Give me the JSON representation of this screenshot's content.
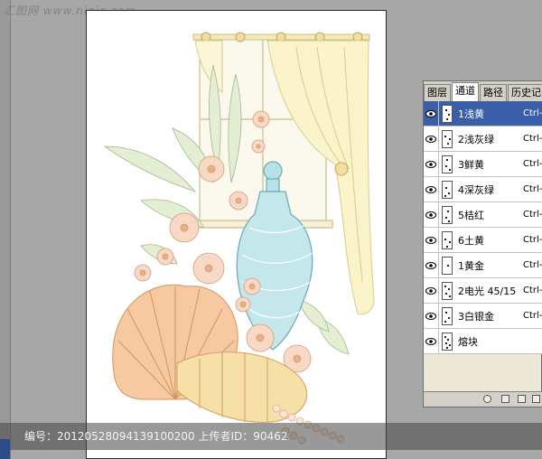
{
  "site_watermark": "汇图网 www.nipic.com",
  "panel": {
    "tabs": [
      "图层",
      "通道",
      "路径",
      "历史记录"
    ],
    "active_tab": 1,
    "channels": [
      {
        "name": "1浅黄",
        "shortcut": "Ctrl-",
        "selected": true
      },
      {
        "name": "2浅灰绿",
        "shortcut": "Ctrl-",
        "selected": false
      },
      {
        "name": "3鲜黄",
        "shortcut": "Ctrl-",
        "selected": false
      },
      {
        "name": "4深灰绿",
        "shortcut": "Ctrl-",
        "selected": false
      },
      {
        "name": "5桔红",
        "shortcut": "Ctrl-",
        "selected": false
      },
      {
        "name": "6土黄",
        "shortcut": "Ctrl-",
        "selected": false
      },
      {
        "name": "1黄金",
        "shortcut": "Ctrl-",
        "selected": false
      },
      {
        "name": "2电光 45/15",
        "shortcut": "Ctrl-",
        "selected": false
      },
      {
        "name": "3白银金",
        "shortcut": "Ctrl-",
        "selected": false
      },
      {
        "name": "熔块",
        "shortcut": "",
        "selected": false
      }
    ]
  },
  "footer": {
    "text": "编号：20120528094139100200 上传者ID：90462"
  },
  "colors": {
    "selected_row": "#3a5fa8",
    "workspace": "#a7a7a7",
    "canvas": "#ffffff"
  }
}
